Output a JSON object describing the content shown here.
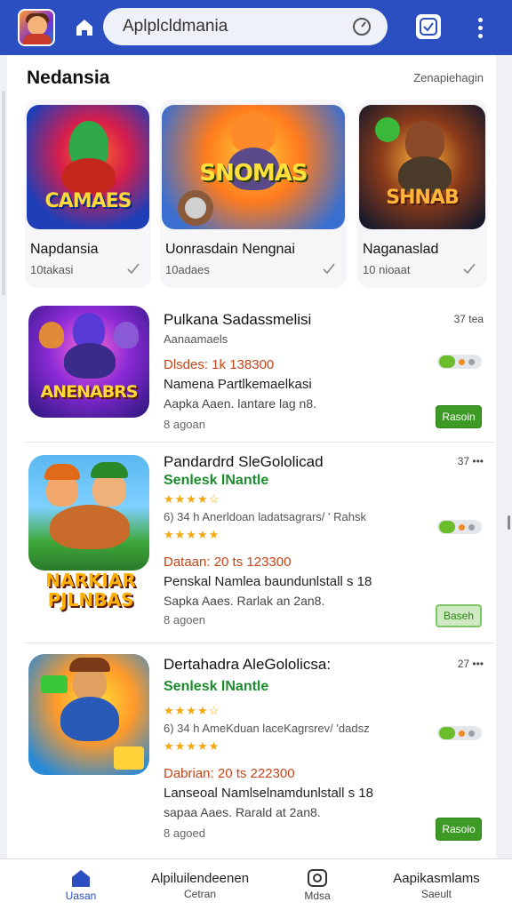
{
  "header": {
    "search_value": "Aplplcldmania",
    "search_placeholder": "Aplplcldmania"
  },
  "section": {
    "title": "Nedansia",
    "link": "Zenapiehagin"
  },
  "featured": [
    {
      "name": "Napdansia",
      "sub": "10takasi",
      "logo": "CAMAES"
    },
    {
      "name": "Uonrasdain Nengnai",
      "sub": "10adaes",
      "logo": "SNOMAS"
    },
    {
      "name": "Naganaslad",
      "sub": "10 nioaat",
      "logo": "SHNAB"
    }
  ],
  "list": [
    {
      "title": "Pulkana Sadassmelisi",
      "meta": "Aanaamaels",
      "downloads": "Dlsdes: 1k 138300",
      "desc1": "Namena Partlkemaelkasi",
      "desc2": "Aapka Aaen. lantare lag n8.",
      "size": "8 agoan",
      "count": "37 tea",
      "button": "Rasoin",
      "logo": "ANENABRS"
    },
    {
      "title": "Pandardrd SleGololicad",
      "subtitle": "Senlesk lNantle",
      "stars_top": "★★★★☆",
      "meta": "6) 34 h  Anerldoan ladatsagrars/ ' Rahsk",
      "stars_bottom": "★★★★★",
      "downloads": "Dataan: 20 ts 123300",
      "desc1": "Penskal Namlea baundunlstall s 18",
      "desc2": "Sapka Aaes. Rarlak an 2an8.",
      "size": "8 agoen",
      "count": "37 •••",
      "button": "Baseh",
      "logo": "NARKIAR PJLNBAS"
    },
    {
      "title": "Dertahadra AleGololicsa:",
      "subtitle": "Senlesk lNantle",
      "stars_top": "★★★★☆",
      "meta": "6) 34 h  AmeKduan laceKagrsrev/ 'dadsz",
      "stars_bottom": "★★★★★",
      "downloads": "Dabrian: 20 ts 222300",
      "desc1": "Lanseoal Namlselnamdunlstall s 18",
      "desc2": "sapaa Aaes. Rarald at 2an8.",
      "size": "8 agoed",
      "count": "27 •••",
      "button": "Rasoio",
      "logo": ""
    }
  ],
  "bottom_nav": [
    {
      "label": "Uasan",
      "icon": "home-icon"
    },
    {
      "label_top": "Alpiluilendeenen",
      "label": "Cetran",
      "icon": ""
    },
    {
      "label": "Mdsa",
      "icon": "camera-icon"
    },
    {
      "label_top": "Aapikasmlams",
      "label": "Saeult",
      "icon": ""
    }
  ],
  "colors": {
    "topbar": "#2b4fc0",
    "accent_green": "#3d9b25",
    "downloads_text": "#c84316",
    "subtitle_green": "#1e8c2e"
  }
}
